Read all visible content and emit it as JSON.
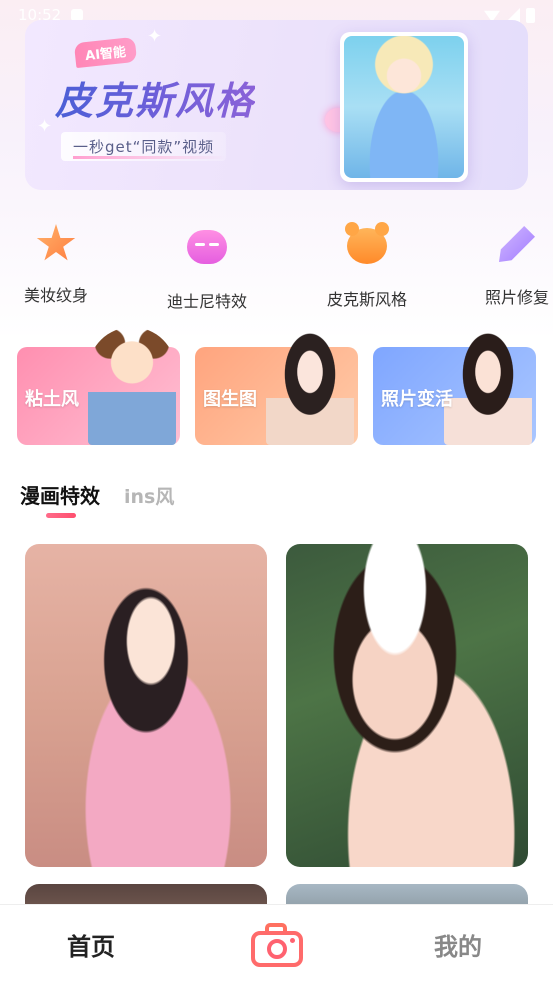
{
  "status_bar": {
    "time": "10:52"
  },
  "banner": {
    "tag": "AI智能",
    "title": "皮克斯风格",
    "subtitle": "一秒get“同款”视频"
  },
  "quick_categories": [
    {
      "label": "美妆纹身",
      "icon": "star-wand-icon",
      "color": "#ff8a45"
    },
    {
      "label": "迪士尼特效",
      "icon": "robot-face-icon",
      "color": "#f06ee2"
    },
    {
      "label": "皮克斯风格",
      "icon": "bear-face-icon",
      "color": "#ff9a3a"
    },
    {
      "label": "照片修复",
      "icon": "pen-icon",
      "color": "#a985ff"
    }
  ],
  "feature_cards": [
    {
      "label": "粘土风",
      "color": "#ff8fb0"
    },
    {
      "label": "图生图",
      "color": "#ffa47e"
    },
    {
      "label": "照片变活",
      "color": "#7fa6ff"
    }
  ],
  "tabs": [
    {
      "label": "漫画特效",
      "active": true
    },
    {
      "label": "ins风",
      "active": false
    }
  ],
  "bottom_nav": {
    "home": "首页",
    "camera_icon": "camera-icon",
    "mine": "我的"
  }
}
